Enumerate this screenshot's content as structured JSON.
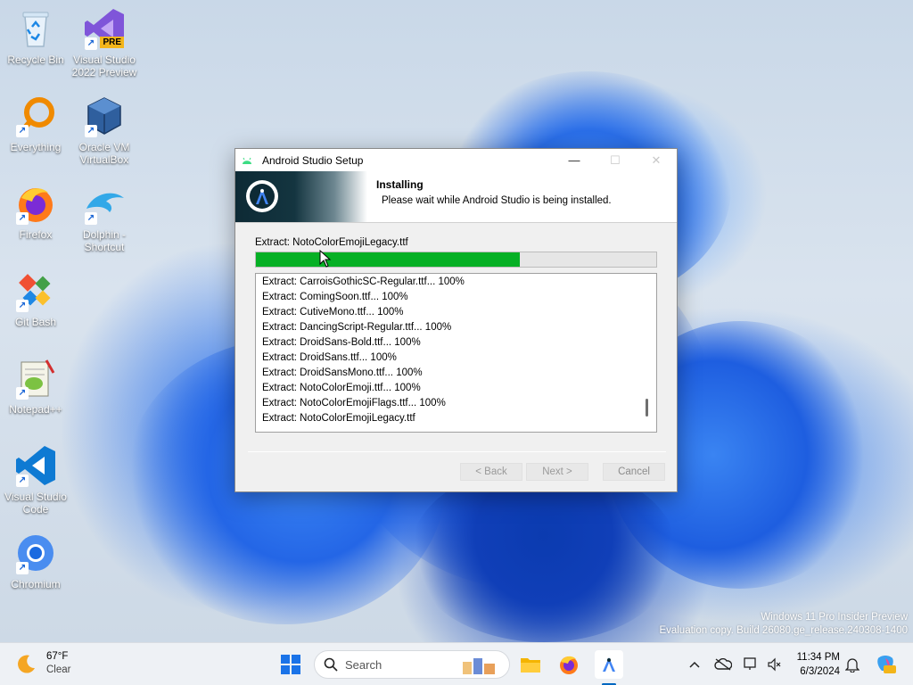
{
  "desktop": {
    "icons": [
      {
        "label_line1": "Recycle Bin",
        "label_line2": ""
      },
      {
        "label_line1": "Visual Studio",
        "label_line2": "2022 Preview",
        "badge": "PRE"
      },
      {
        "label_line1": "Everything",
        "label_line2": ""
      },
      {
        "label_line1": "Oracle VM",
        "label_line2": "VirtualBox"
      },
      {
        "label_line1": "Firefox",
        "label_line2": ""
      },
      {
        "label_line1": "Dolphin -",
        "label_line2": "Shortcut"
      },
      {
        "label_line1": "Git Bash",
        "label_line2": ""
      },
      {
        "label_line1": "Notepad++",
        "label_line2": ""
      },
      {
        "label_line1": "Visual Studio",
        "label_line2": "Code"
      },
      {
        "label_line1": "Chromium",
        "label_line2": ""
      }
    ],
    "watermark_line1": "Windows 11 Pro Insider Preview",
    "watermark_line2": "Evaluation copy. Build 26080.ge_release.240308-1400"
  },
  "installer": {
    "title": "Android Studio Setup",
    "header_title": "Installing",
    "header_subtitle": "Please wait while Android Studio is being installed.",
    "current_file": "Extract: NotoColorEmojiLegacy.ttf",
    "progress_fraction": 0.66,
    "log": [
      "Extract: CarroisGothicSC-Regular.ttf... 100%",
      "Extract: ComingSoon.ttf... 100%",
      "Extract: CutiveMono.ttf... 100%",
      "Extract: DancingScript-Regular.ttf... 100%",
      "Extract: DroidSans-Bold.ttf... 100%",
      "Extract: DroidSans.ttf... 100%",
      "Extract: DroidSansMono.ttf... 100%",
      "Extract: NotoColorEmoji.ttf... 100%",
      "Extract: NotoColorEmojiFlags.ttf... 100%",
      "Extract: NotoColorEmojiLegacy.ttf"
    ],
    "buttons": {
      "back": "< Back",
      "next": "Next >",
      "cancel": "Cancel"
    },
    "minimize_glyph": "—",
    "maximize_glyph": "☐",
    "close_glyph": "✕"
  },
  "taskbar": {
    "weather_temp": "67°F",
    "weather_condition": "Clear",
    "search_placeholder": "Search",
    "clock_time": "11:34 PM",
    "clock_date": "6/3/2024",
    "accent_color": "#0067c0"
  }
}
